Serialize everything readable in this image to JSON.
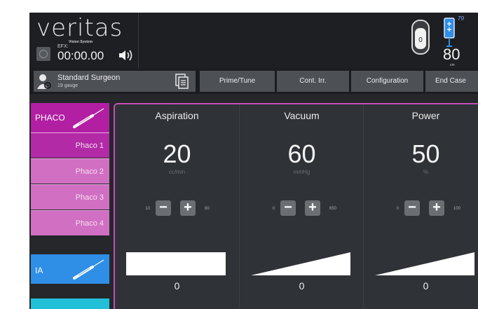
{
  "header": {
    "brand": "veritas",
    "brand_sub": "Vision System",
    "efx_label": "EFX:",
    "efx_time": "00:00.00",
    "bottle_number": "79",
    "bottle_height": "80",
    "bottle_unit": "cm"
  },
  "toolbar": {
    "surgeon_name": "Standard Surgeon",
    "surgeon_gauge": "19 gauge",
    "prime_tune": "Prime/Tune",
    "cont_irr": "Cont. Irr.",
    "configuration": "Configuration",
    "end_case": "End Case"
  },
  "modes": {
    "phaco": "PHACO",
    "phaco_sub": [
      "Phaco 1",
      "Phaco 2",
      "Phaco 3",
      "Phaco 4"
    ],
    "ia": "IA"
  },
  "params": [
    {
      "title": "Aspiration",
      "value": "20",
      "unit": "cc/min",
      "min": "10",
      "max": "60",
      "current": "0"
    },
    {
      "title": "Vacuum",
      "value": "60",
      "unit": "mmHg",
      "min": "0",
      "max": "650",
      "current": "0"
    },
    {
      "title": "Power",
      "value": "50",
      "unit": "%",
      "min": "0",
      "max": "100",
      "current": "0"
    }
  ],
  "colors": {
    "phaco_accent": "#b21fa3",
    "ia_accent": "#2f8ee6"
  }
}
